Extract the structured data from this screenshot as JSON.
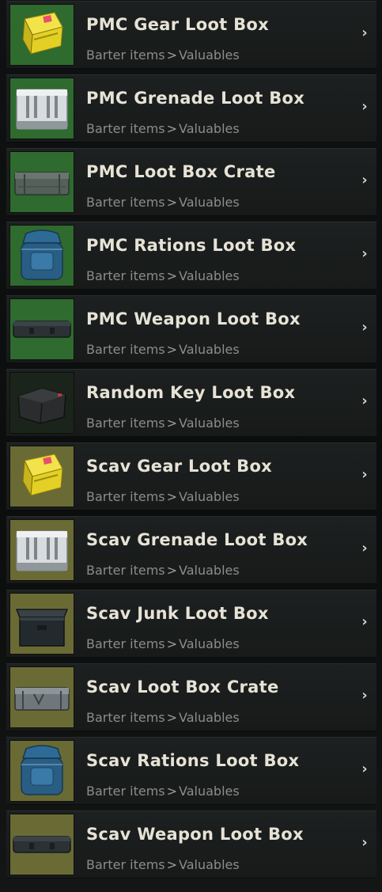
{
  "colors": {
    "pmc_bg": "#2f6a2f",
    "scav_bg": "#6a6a35",
    "key_bg": "#1b241b",
    "title": "#e6e3d6",
    "subtitle": "#8a8d89"
  },
  "items": [
    {
      "title": "PMC Gear Loot Box",
      "category": "Barter items",
      "subcategory": "Valuables",
      "icon": "yellow-case-icon",
      "bg": "pmc"
    },
    {
      "title": "PMC Grenade Loot Box",
      "category": "Barter items",
      "subcategory": "Valuables",
      "icon": "grenade-crate-icon",
      "bg": "pmc"
    },
    {
      "title": "PMC Loot Box Crate",
      "category": "Barter items",
      "subcategory": "Valuables",
      "icon": "long-crate-icon",
      "bg": "pmc"
    },
    {
      "title": "PMC Rations Loot Box",
      "category": "Barter items",
      "subcategory": "Valuables",
      "icon": "rations-bag-icon",
      "bg": "pmc"
    },
    {
      "title": "PMC Weapon Loot Box",
      "category": "Barter items",
      "subcategory": "Valuables",
      "icon": "weapon-case-icon",
      "bg": "pmc"
    },
    {
      "title": "Random Key Loot Box",
      "category": "Barter items",
      "subcategory": "Valuables",
      "icon": "key-pouch-icon",
      "bg": "key"
    },
    {
      "title": "Scav Gear Loot Box",
      "category": "Barter items",
      "subcategory": "Valuables",
      "icon": "yellow-case-icon",
      "bg": "scav"
    },
    {
      "title": "Scav Grenade Loot Box",
      "category": "Barter items",
      "subcategory": "Valuables",
      "icon": "grenade-crate-icon",
      "bg": "scav"
    },
    {
      "title": "Scav Junk Loot Box",
      "category": "Barter items",
      "subcategory": "Valuables",
      "icon": "junk-box-icon",
      "bg": "scav"
    },
    {
      "title": "Scav Loot Box Crate",
      "category": "Barter items",
      "subcategory": "Valuables",
      "icon": "metal-crate-icon",
      "bg": "scav"
    },
    {
      "title": "Scav Rations Loot Box",
      "category": "Barter items",
      "subcategory": "Valuables",
      "icon": "rations-bag-icon",
      "bg": "scav"
    },
    {
      "title": "Scav Weapon Loot Box",
      "category": "Barter items",
      "subcategory": "Valuables",
      "icon": "weapon-case-icon",
      "bg": "scav"
    }
  ],
  "separator": ">",
  "chevron": "›"
}
